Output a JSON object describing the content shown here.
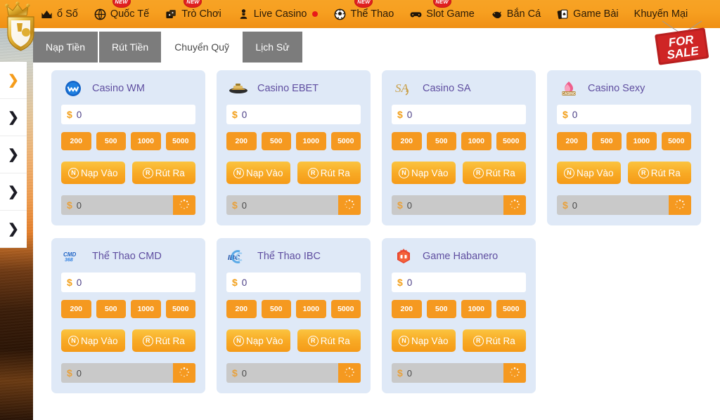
{
  "brand": {
    "logo_icon": "crown-shield-logo"
  },
  "topnav": {
    "items": [
      {
        "label": "ổ Số",
        "icon": "crown-lottery-icon",
        "new": false,
        "live": false
      },
      {
        "label": "Quốc Tế",
        "icon": "globe-international-icon",
        "new": true,
        "live": false
      },
      {
        "label": "Trò Chơi",
        "icon": "dice-games-icon",
        "new": true,
        "live": false
      },
      {
        "label": "Live Casino",
        "icon": "chess-pawn-icon",
        "new": false,
        "live": true
      },
      {
        "label": "Thể Thao",
        "icon": "soccer-ball-icon",
        "new": true,
        "live": false
      },
      {
        "label": "Slot Game",
        "icon": "gamepad-icon",
        "new": true,
        "live": false
      },
      {
        "label": "Bắn Cá",
        "icon": "fish-icon",
        "new": false,
        "live": false
      },
      {
        "label": "Game Bài",
        "icon": "playing-cards-icon",
        "new": false,
        "live": false
      },
      {
        "label": "Khuyến Mại",
        "icon": "",
        "new": false,
        "live": false
      }
    ],
    "new_badge_text": "NEW"
  },
  "tabs": [
    {
      "label": "Nạp Tiền",
      "active": false
    },
    {
      "label": "Rút Tiền",
      "active": false
    },
    {
      "label": "Chuyển Quỹ",
      "active": true
    },
    {
      "label": "Lịch Sử",
      "active": false
    }
  ],
  "sidebar": {
    "arrows": [
      {
        "icon": "chevron-right-icon",
        "accent": true
      },
      {
        "icon": "chevron-right-icon",
        "accent": false
      },
      {
        "icon": "chevron-right-icon",
        "accent": false
      },
      {
        "icon": "chevron-right-icon",
        "accent": false
      },
      {
        "icon": "chevron-right-icon",
        "accent": false
      }
    ]
  },
  "for_sale_sign": {
    "line1": "FOR",
    "line2": "SALE"
  },
  "card_common": {
    "currency_symbol": "$",
    "input_value": "0",
    "input_placeholder": "0",
    "quick_amounts": [
      "200",
      "500",
      "1000",
      "5000"
    ],
    "deposit_label": "Nạp Vào",
    "deposit_icon_letter": "N",
    "withdraw_label": "Rút Ra",
    "withdraw_icon_letter": "R",
    "balance_value": "0",
    "refresh_icon": "refresh-spinner-icon"
  },
  "colors": {
    "nav_orange": "#f79f20",
    "accent_orange": "#f59920",
    "card_bg": "#dfe9f7",
    "title_purple": "#5f4ea0",
    "tab_grey": "#7c7c7c"
  },
  "cards": [
    {
      "title": "Casino WM",
      "logo": "wm-logo-icon"
    },
    {
      "title": "Casino EBET",
      "logo": "ebet-logo-icon"
    },
    {
      "title": "Casino SA",
      "logo": "sa-logo-icon"
    },
    {
      "title": "Casino Sexy",
      "logo": "sexy-logo-icon"
    },
    {
      "title": "Thể Thao CMD",
      "logo": "cmd-logo-icon"
    },
    {
      "title": "Thể Thao IBC",
      "logo": "ibc-logo-icon"
    },
    {
      "title": "Game Habanero",
      "logo": "habanero-logo-icon"
    }
  ]
}
